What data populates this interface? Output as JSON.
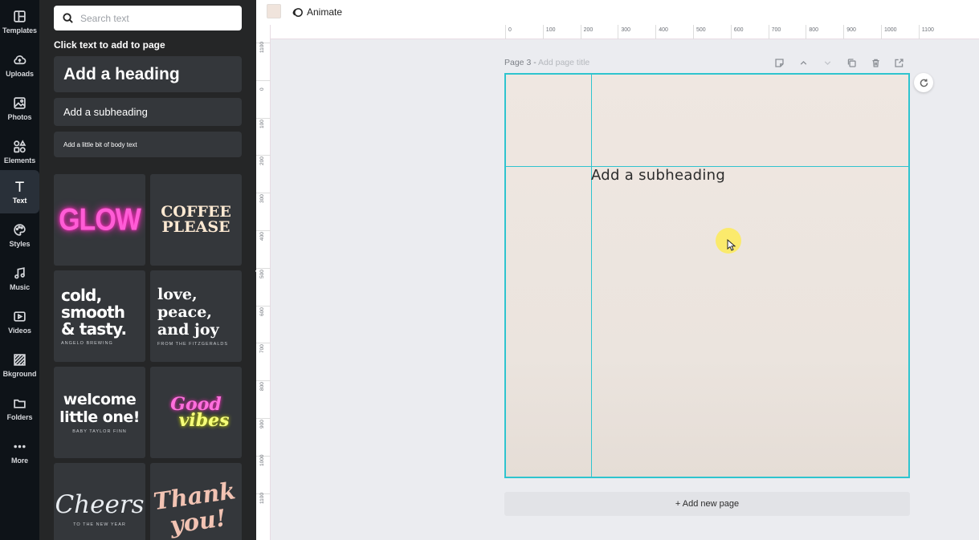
{
  "rail": {
    "items": [
      {
        "label": "Templates",
        "icon": "templates-icon"
      },
      {
        "label": "Uploads",
        "icon": "upload-cloud-icon"
      },
      {
        "label": "Photos",
        "icon": "image-icon"
      },
      {
        "label": "Elements",
        "icon": "shapes-icon"
      },
      {
        "label": "Text",
        "icon": "text-t-icon",
        "active": true
      },
      {
        "label": "Styles",
        "icon": "palette-icon"
      },
      {
        "label": "Music",
        "icon": "music-note-icon"
      },
      {
        "label": "Videos",
        "icon": "video-play-icon"
      },
      {
        "label": "Bkground",
        "icon": "background-hatch-icon"
      },
      {
        "label": "Folders",
        "icon": "folder-icon"
      },
      {
        "label": "More",
        "icon": "more-dots-icon"
      }
    ]
  },
  "panel": {
    "search_placeholder": "Search text",
    "title": "Click text to add to page",
    "add_heading": "Add a heading",
    "add_subheading": "Add a subheading",
    "add_body": "Add a little bit of body text",
    "templates": {
      "glow": "GLOW",
      "coffee_1": "COFFEE",
      "coffee_2": "PLEASE",
      "cold_1": "cold,",
      "cold_2": "smooth",
      "cold_3": "& tasty.",
      "cold_caption": "ANGELO BREWING",
      "love_1": "love,",
      "love_2": "peace,",
      "love_3": "and joy",
      "love_caption": "FROM THE FITZGERALDS",
      "welcome_1": "welcome",
      "welcome_2": "little one!",
      "welcome_caption": "BABY TAYLOR FINN",
      "good_1": "Good",
      "good_2": "vibes",
      "cheers": "Cheers",
      "cheers_caption": "TO THE NEW YEAR",
      "thank_1": "Thank",
      "thank_2": "you!"
    }
  },
  "topbar": {
    "animate_label": "Animate",
    "swatch_color": "#f0e4dc"
  },
  "ruler": {
    "h_ticks": [
      "0",
      "100",
      "200",
      "300",
      "400",
      "500",
      "600",
      "700",
      "800",
      "900",
      "1000",
      "1100"
    ],
    "v_ticks": [
      "1100",
      "0",
      "100",
      "200",
      "300",
      "400",
      "500",
      "600",
      "700",
      "800",
      "900",
      "1000",
      "1100"
    ]
  },
  "page": {
    "label": "Page 3 - ",
    "title_placeholder": "Add page title",
    "canvas_text": "Add a subheading",
    "add_new_page": "+ Add new page"
  },
  "colors": {
    "guide": "#2fc4cf",
    "panel_bg": "#252627",
    "rail_bg": "#0e1318"
  }
}
